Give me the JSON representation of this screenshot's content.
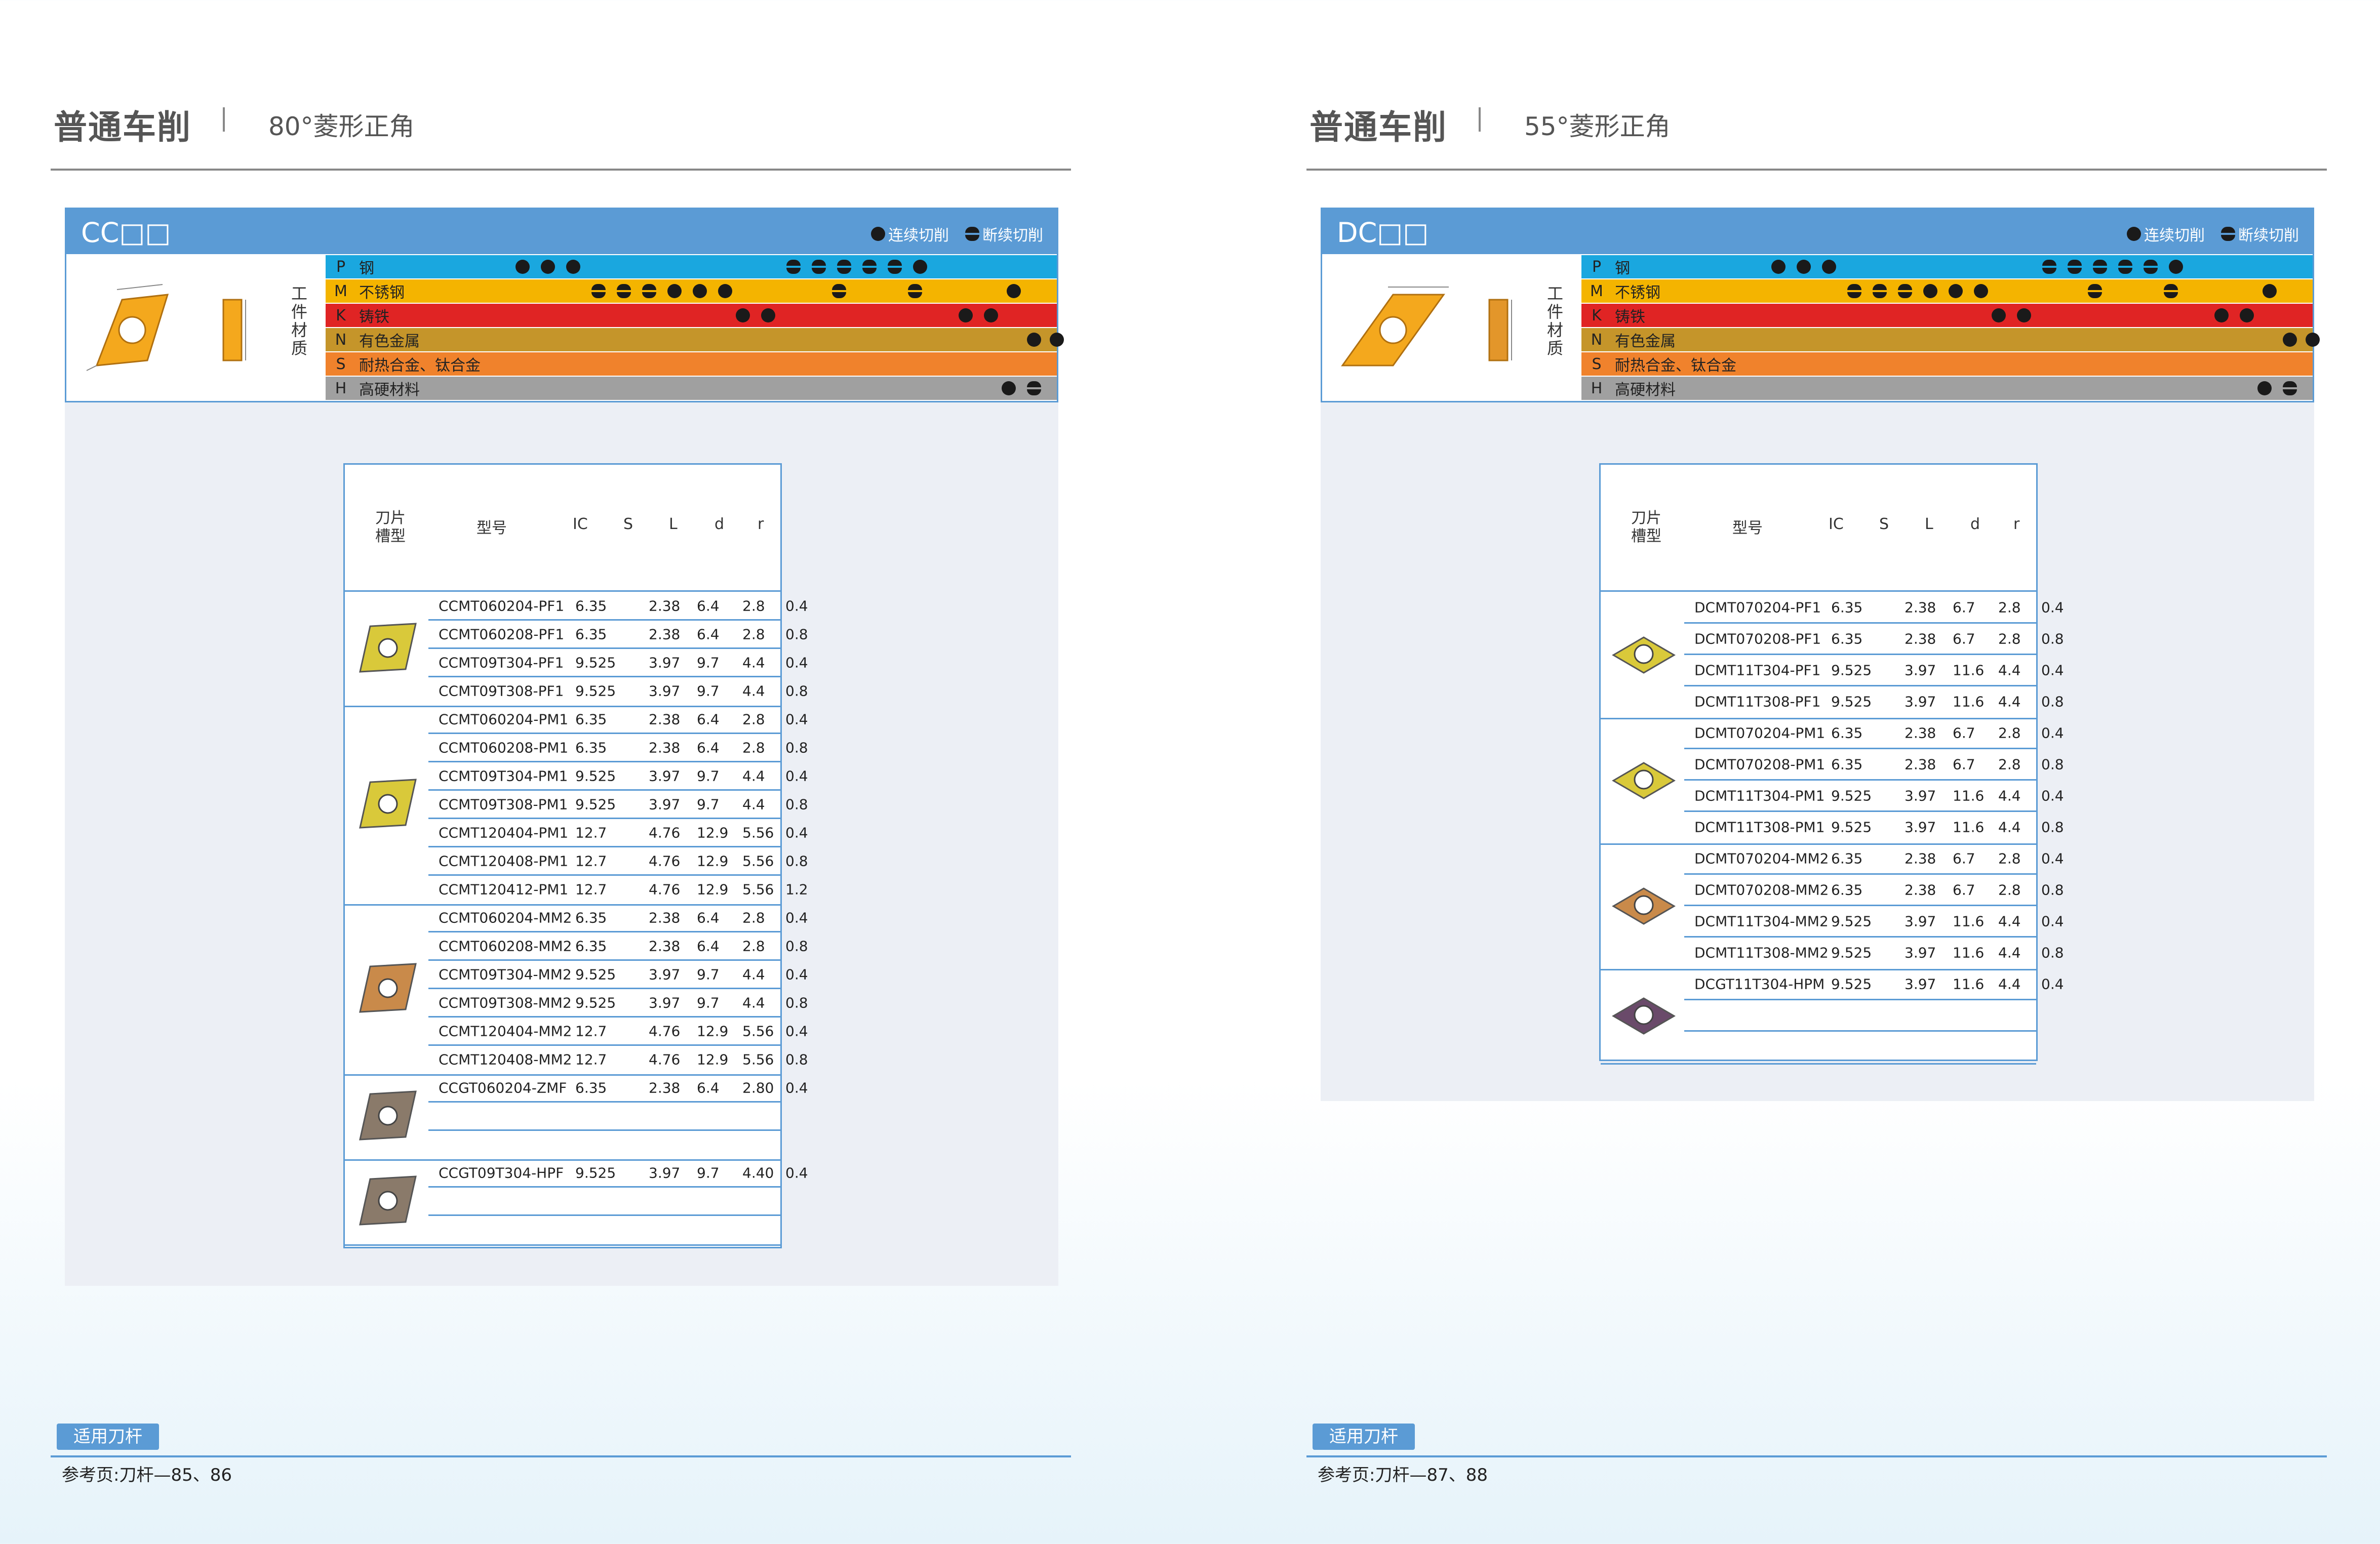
{
  "colors": {
    "accent_blue": "#5b9bd5",
    "mat_P": "#1aa7df",
    "mat_M": "#f4b400",
    "mat_K": "#e02424",
    "mat_N": "#c5952a",
    "mat_S": "#f0822c",
    "mat_H": "#a0a0a0"
  },
  "icons": {
    "full_dot": "filled-circle-icon",
    "half_dot": "split-circle-icon"
  },
  "pages": [
    {
      "title": "普通车削",
      "subtitle": "80°菱形正角",
      "code": "CC□□",
      "legend_cont": "连续切削",
      "legend_interrupt": "断续切削",
      "workpiece_label": "工件材质",
      "materials": [
        {
          "code": "P",
          "name": "钢"
        },
        {
          "code": "M",
          "name": "不锈钢"
        },
        {
          "code": "K",
          "name": "铸铁"
        },
        {
          "code": "N",
          "name": "有色金属"
        },
        {
          "code": "S",
          "name": "耐热合金、钛合金"
        },
        {
          "code": "H",
          "name": "高硬材料"
        }
      ],
      "headers": {
        "groove": "刀片槽型",
        "model": "型号",
        "ic": "IC",
        "s": "S",
        "l": "L",
        "d": "d",
        "r": "r"
      },
      "groups": [
        {
          "color": "yellow",
          "rows": [
            [
              "CCMT060204-PF1",
              "6.35",
              "2.38",
              "6.4",
              "2.8",
              "0.4"
            ],
            [
              "CCMT060208-PF1",
              "6.35",
              "2.38",
              "6.4",
              "2.8",
              "0.8"
            ],
            [
              "CCMT09T304-PF1",
              "9.525",
              "3.97",
              "9.7",
              "4.4",
              "0.4"
            ],
            [
              "CCMT09T308-PF1",
              "9.525",
              "3.97",
              "9.7",
              "4.4",
              "0.8"
            ]
          ]
        },
        {
          "color": "yellow",
          "rows": [
            [
              "CCMT060204-PM1",
              "6.35",
              "2.38",
              "6.4",
              "2.8",
              "0.4"
            ],
            [
              "CCMT060208-PM1",
              "6.35",
              "2.38",
              "6.4",
              "2.8",
              "0.8"
            ],
            [
              "CCMT09T304-PM1",
              "9.525",
              "3.97",
              "9.7",
              "4.4",
              "0.4"
            ],
            [
              "CCMT09T308-PM1",
              "9.525",
              "3.97",
              "9.7",
              "4.4",
              "0.8"
            ],
            [
              "CCMT120404-PM1",
              "12.7",
              "4.76",
              "12.9",
              "5.56",
              "0.4"
            ],
            [
              "CCMT120408-PM1",
              "12.7",
              "4.76",
              "12.9",
              "5.56",
              "0.8"
            ],
            [
              "CCMT120412-PM1",
              "12.7",
              "4.76",
              "12.9",
              "5.56",
              "1.2"
            ]
          ]
        },
        {
          "color": "bronze",
          "rows": [
            [
              "CCMT060204-MM2",
              "6.35",
              "2.38",
              "6.4",
              "2.8",
              "0.4"
            ],
            [
              "CCMT060208-MM2",
              "6.35",
              "2.38",
              "6.4",
              "2.8",
              "0.8"
            ],
            [
              "CCMT09T304-MM2",
              "9.525",
              "3.97",
              "9.7",
              "4.4",
              "0.4"
            ],
            [
              "CCMT09T308-MM2",
              "9.525",
              "3.97",
              "9.7",
              "4.4",
              "0.8"
            ],
            [
              "CCMT120404-MM2",
              "12.7",
              "4.76",
              "12.9",
              "5.56",
              "0.4"
            ],
            [
              "CCMT120408-MM2",
              "12.7",
              "4.76",
              "12.9",
              "5.56",
              "0.8"
            ]
          ]
        },
        {
          "color": "grey",
          "rows": [
            [
              "CCGT060204-ZMF",
              "6.35",
              "2.38",
              "6.4",
              "2.80",
              "0.4"
            ],
            [
              "",
              "",
              "",
              "",
              "",
              ""
            ],
            [
              "",
              "",
              "",
              "",
              "",
              ""
            ]
          ]
        },
        {
          "color": "grey",
          "rows": [
            [
              "CCGT09T304-HPF",
              "9.525",
              "3.97",
              "9.7",
              "4.40",
              "0.4"
            ],
            [
              "",
              "",
              "",
              "",
              "",
              ""
            ],
            [
              "",
              "",
              "",
              "",
              "",
              ""
            ]
          ]
        }
      ],
      "footer_tag": "适用刀杆",
      "footer_ref": "参考页:刀杆—85、86"
    },
    {
      "title": "普通车削",
      "subtitle": "55°菱形正角",
      "code": "DC□□",
      "legend_cont": "连续切削",
      "legend_interrupt": "断续切削",
      "workpiece_label": "工件材质",
      "materials": [
        {
          "code": "P",
          "name": "钢"
        },
        {
          "code": "M",
          "name": "不锈钢"
        },
        {
          "code": "K",
          "name": "铸铁"
        },
        {
          "code": "N",
          "name": "有色金属"
        },
        {
          "code": "S",
          "name": "耐热合金、钛合金"
        },
        {
          "code": "H",
          "name": "高硬材料"
        }
      ],
      "headers": {
        "groove": "刀片槽型",
        "model": "型号",
        "ic": "IC",
        "s": "S",
        "l": "L",
        "d": "d",
        "r": "r"
      },
      "groups": [
        {
          "color": "yellow",
          "rows": [
            [
              "DCMT070204-PF1",
              "6.35",
              "2.38",
              "6.7",
              "2.8",
              "0.4"
            ],
            [
              "DCMT070208-PF1",
              "6.35",
              "2.38",
              "6.7",
              "2.8",
              "0.8"
            ],
            [
              "DCMT11T304-PF1",
              "9.525",
              "3.97",
              "11.6",
              "4.4",
              "0.4"
            ],
            [
              "DCMT11T308-PF1",
              "9.525",
              "3.97",
              "11.6",
              "4.4",
              "0.8"
            ]
          ]
        },
        {
          "color": "yellow",
          "rows": [
            [
              "DCMT070204-PM1",
              "6.35",
              "2.38",
              "6.7",
              "2.8",
              "0.4"
            ],
            [
              "DCMT070208-PM1",
              "6.35",
              "2.38",
              "6.7",
              "2.8",
              "0.8"
            ],
            [
              "DCMT11T304-PM1",
              "9.525",
              "3.97",
              "11.6",
              "4.4",
              "0.4"
            ],
            [
              "DCMT11T308-PM1",
              "9.525",
              "3.97",
              "11.6",
              "4.4",
              "0.8"
            ]
          ]
        },
        {
          "color": "bronze",
          "rows": [
            [
              "DCMT070204-MM2",
              "6.35",
              "2.38",
              "6.7",
              "2.8",
              "0.4"
            ],
            [
              "DCMT070208-MM2",
              "6.35",
              "2.38",
              "6.7",
              "2.8",
              "0.8"
            ],
            [
              "DCMT11T304-MM2",
              "9.525",
              "3.97",
              "11.6",
              "4.4",
              "0.4"
            ],
            [
              "DCMT11T308-MM2",
              "9.525",
              "3.97",
              "11.6",
              "4.4",
              "0.8"
            ]
          ]
        },
        {
          "color": "purple",
          "rows": [
            [
              "DCGT11T304-HPM",
              "9.525",
              "3.97",
              "11.6",
              "4.4",
              "0.4"
            ],
            [
              "",
              "",
              "",
              "",
              "",
              ""
            ],
            [
              "",
              "",
              "",
              "",
              "",
              ""
            ]
          ]
        }
      ],
      "footer_tag": "适用刀杆",
      "footer_ref": "参考页:刀杆—87、88"
    }
  ]
}
